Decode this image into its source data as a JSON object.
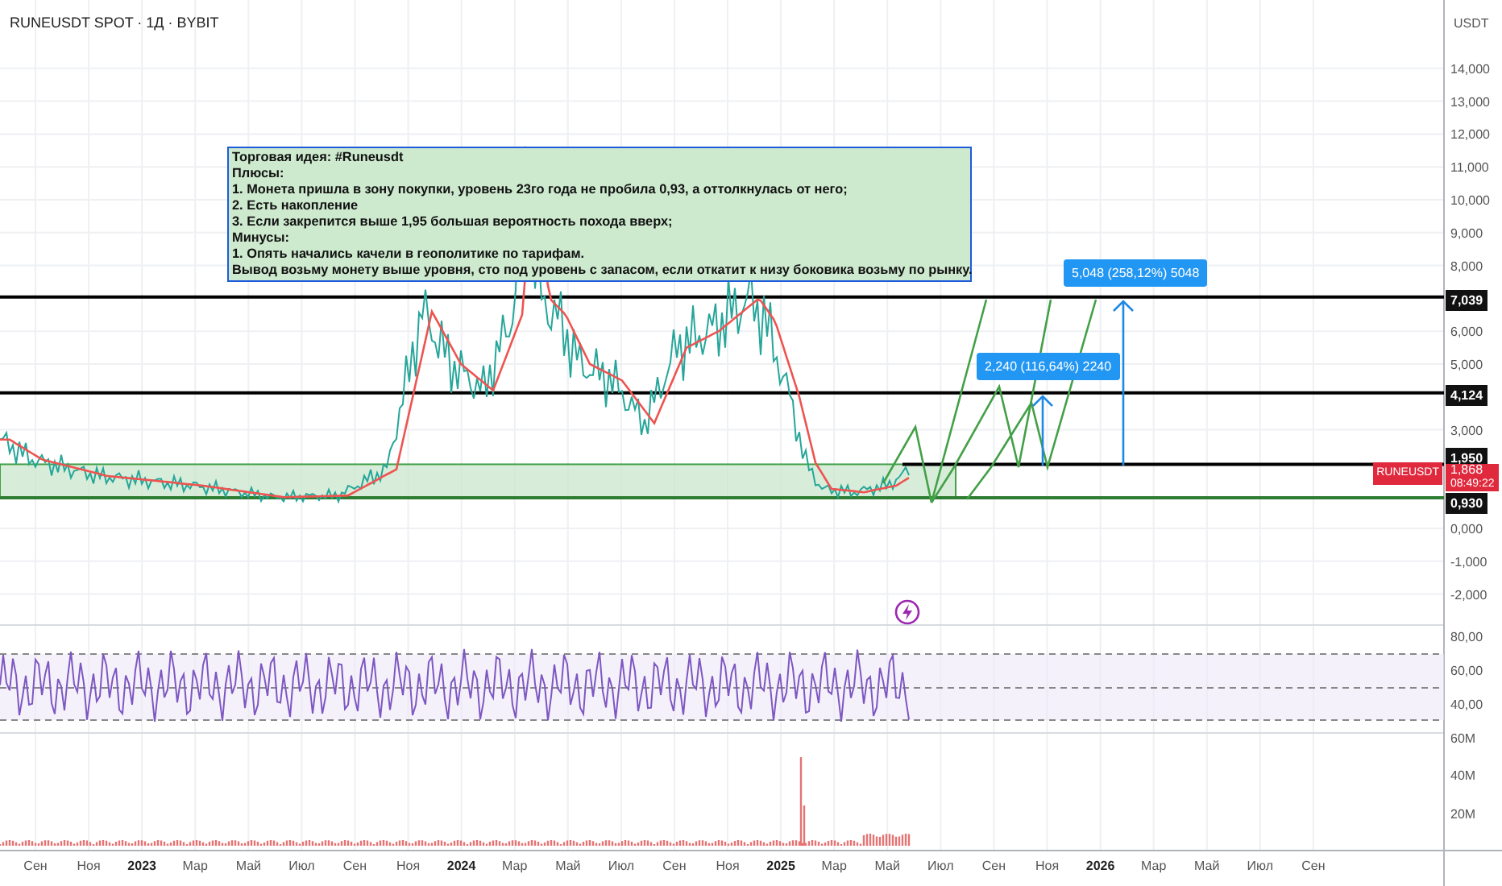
{
  "header": {
    "title": "RUNEUSDT SPOT · 1Д · BYBIT"
  },
  "price_axis": {
    "unit": "USDT",
    "ticks": [
      "14,000",
      "13,000",
      "12,000",
      "11,000",
      "10,000",
      "9,000",
      "8,000",
      "6,000",
      "5,000",
      "3,000",
      "0,000",
      "-1,000",
      "-2,000"
    ]
  },
  "levels": [
    {
      "label": "7,039"
    },
    {
      "label": "4,124"
    },
    {
      "label": "1,950"
    },
    {
      "label": "0,930"
    }
  ],
  "last_price": {
    "symbol": "RUNEUSDT",
    "price": "1,868",
    "countdown": "08:49:22"
  },
  "note": {
    "lines": [
      "Торговая идея: #Runeusdt",
      "Плюсы:",
      "1. Монета пришла в зону покупки, уровень 23го года не пробила 0,93, а оттолкнулась от него;",
      "2. Есть накопление",
      "3. Если закрепится выше 1,95 большая вероятность похода вверх;",
      "Минусы:",
      "1. Опять начались качели в геополитике по тарифам.",
      "Вывод возьму монету выше уровня, сто под уровень с запасом, если откатит к низу боковика возьму по рынку."
    ]
  },
  "targets": [
    {
      "label": "2,240 (116,64%) 2240"
    },
    {
      "label": "5,048 (258,12%) 5048"
    }
  ],
  "rsi_axis": {
    "ticks": [
      "80,00",
      "60,00",
      "40,00"
    ]
  },
  "volume_axis": {
    "ticks": [
      "60M",
      "40M",
      "20M"
    ]
  },
  "time_axis": {
    "labels": [
      "Сен",
      "Ноя",
      "2023",
      "Мар",
      "Май",
      "Июл",
      "Сен",
      "Ноя",
      "2024",
      "Мар",
      "Май",
      "Июл",
      "Сен",
      "Ноя",
      "2025",
      "Мар",
      "Май",
      "Июл",
      "Сен",
      "Ноя",
      "2026",
      "Мар",
      "Май",
      "Июл",
      "Сен"
    ]
  }
}
